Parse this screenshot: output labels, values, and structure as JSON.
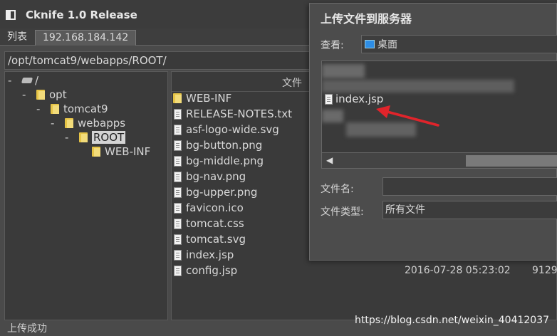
{
  "app": {
    "title": "Cknife 1.0 Release"
  },
  "tabs": [
    {
      "label": "列表"
    },
    {
      "label": "192.168.184.142"
    }
  ],
  "path": "/opt/tomcat9/webapps/ROOT/",
  "tree": [
    {
      "label": "/",
      "icon": "drive-icon"
    },
    {
      "label": "opt",
      "icon": "folder-icon"
    },
    {
      "label": "tomcat9",
      "icon": "folder-icon"
    },
    {
      "label": "webapps",
      "icon": "folder-icon"
    },
    {
      "label": "ROOT",
      "icon": "folder-icon",
      "selected": true
    },
    {
      "label": "WEB-INF",
      "icon": "folder-icon"
    }
  ],
  "files": {
    "header": "文件",
    "rows": [
      {
        "name": "WEB-INF",
        "type": "folder",
        "date": "",
        "size": ""
      },
      {
        "name": "RELEASE-NOTES.txt",
        "type": "file",
        "date": "",
        "size": ""
      },
      {
        "name": "asf-logo-wide.svg",
        "type": "file",
        "date": "",
        "size": ""
      },
      {
        "name": "bg-button.png",
        "type": "file",
        "date": "",
        "size": ""
      },
      {
        "name": "bg-middle.png",
        "type": "file",
        "date": "",
        "size": ""
      },
      {
        "name": "bg-nav.png",
        "type": "file",
        "date": "",
        "size": ""
      },
      {
        "name": "bg-upper.png",
        "type": "file",
        "date": "",
        "size": ""
      },
      {
        "name": "favicon.ico",
        "type": "file",
        "date": "",
        "size": ""
      },
      {
        "name": "tomcat.css",
        "type": "file",
        "date": "",
        "size": ""
      },
      {
        "name": "tomcat.svg",
        "type": "file",
        "date": "",
        "size": ""
      },
      {
        "name": "index.jsp",
        "type": "file",
        "date": "",
        "size": ""
      },
      {
        "name": "config.jsp",
        "type": "file",
        "date": "2016-07-28 05:23:02",
        "size": "9129"
      }
    ]
  },
  "status": "上传成功",
  "watermark": "https://blog.csdn.net/weixin_40412037",
  "dialog": {
    "title": "上传文件到服务器",
    "look_in_label": "查看:",
    "look_in_value": "桌面",
    "selected_file": "index.jsp",
    "filename_label": "文件名:",
    "filename_value": "",
    "filetype_label": "文件类型:",
    "filetype_value": "所有文件"
  },
  "colors": {
    "annotation_arrow": "#e0242b",
    "desktop_icon": "#2e8ee6",
    "folder": "#e6c446"
  }
}
